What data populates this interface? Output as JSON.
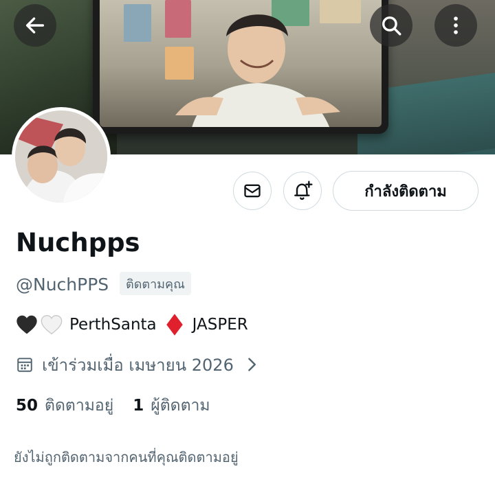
{
  "profile": {
    "display_name": "Nuchpps",
    "handle": "@NuchPPS",
    "follows_you_badge": "ติดตามคุณ",
    "bio": {
      "text_1": "PerthSanta",
      "text_2": "JASPER"
    },
    "joined": "เข้าร่วมเมื่อ เมษายน 2026",
    "following_count": "50",
    "following_label": "ติดตามอยู่",
    "followers_count": "1",
    "followers_label": "ผู้ติดตาม",
    "not_followed_note": "ยังไม่ถูกติดตามจากคนที่คุณติดตามอยู่"
  },
  "actions": {
    "following_button": "กำลังติดตาม"
  },
  "icons": {
    "back": "arrow-left-icon",
    "search": "search-icon",
    "more": "more-vertical-icon",
    "message": "envelope-icon",
    "notify": "bell-plus-icon",
    "calendar": "calendar-icon",
    "chevron": "chevron-right-icon"
  },
  "colors": {
    "primary_text": "#0f1419",
    "secondary_text": "#536471",
    "border": "#cfd9de",
    "badge_bg": "#eff3f4",
    "diamond": "#e0202d"
  }
}
